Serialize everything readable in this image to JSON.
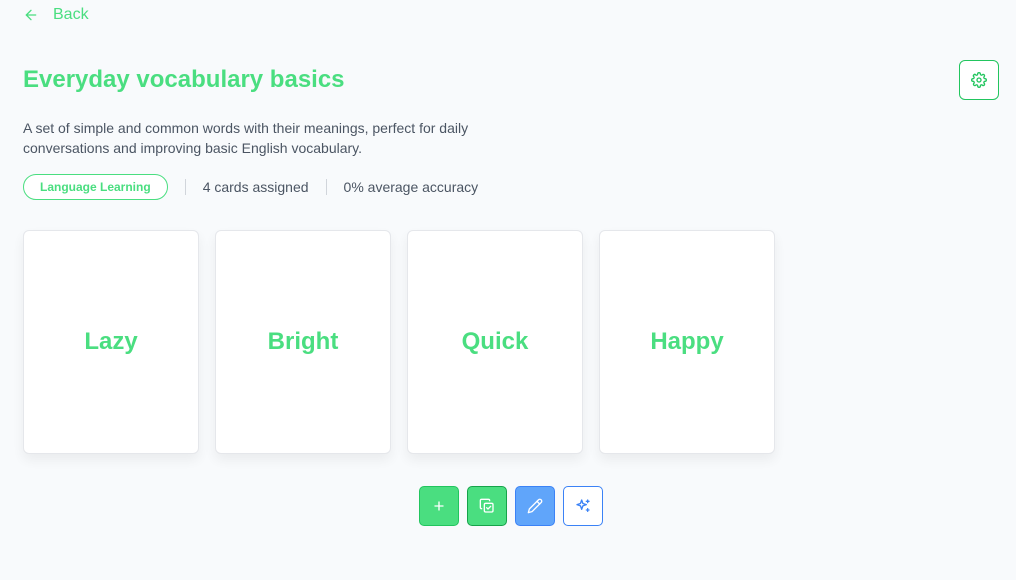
{
  "nav": {
    "back_label": "Back"
  },
  "deck": {
    "title": "Everyday vocabulary basics",
    "description": "A set of simple and common words with their meanings, perfect for daily conversations and improving basic English vocabulary.",
    "category": "Language Learning",
    "cards_assigned": "4 cards assigned",
    "accuracy": "0% average accuracy"
  },
  "cards": [
    {
      "word": "Lazy"
    },
    {
      "word": "Bright"
    },
    {
      "word": "Quick"
    },
    {
      "word": "Happy"
    }
  ],
  "actions": {
    "add_icon": "plus-icon",
    "copy_icon": "copy-check-icon",
    "edit_icon": "pencil-icon",
    "ai_icon": "sparkles-icon",
    "settings_icon": "gear-icon"
  },
  "colors": {
    "accent": "#4ade80",
    "accent_border": "#22c55e",
    "edit_blue": "#60a5fa",
    "outline_blue": "#3b82f6",
    "background": "#f8fafc"
  }
}
